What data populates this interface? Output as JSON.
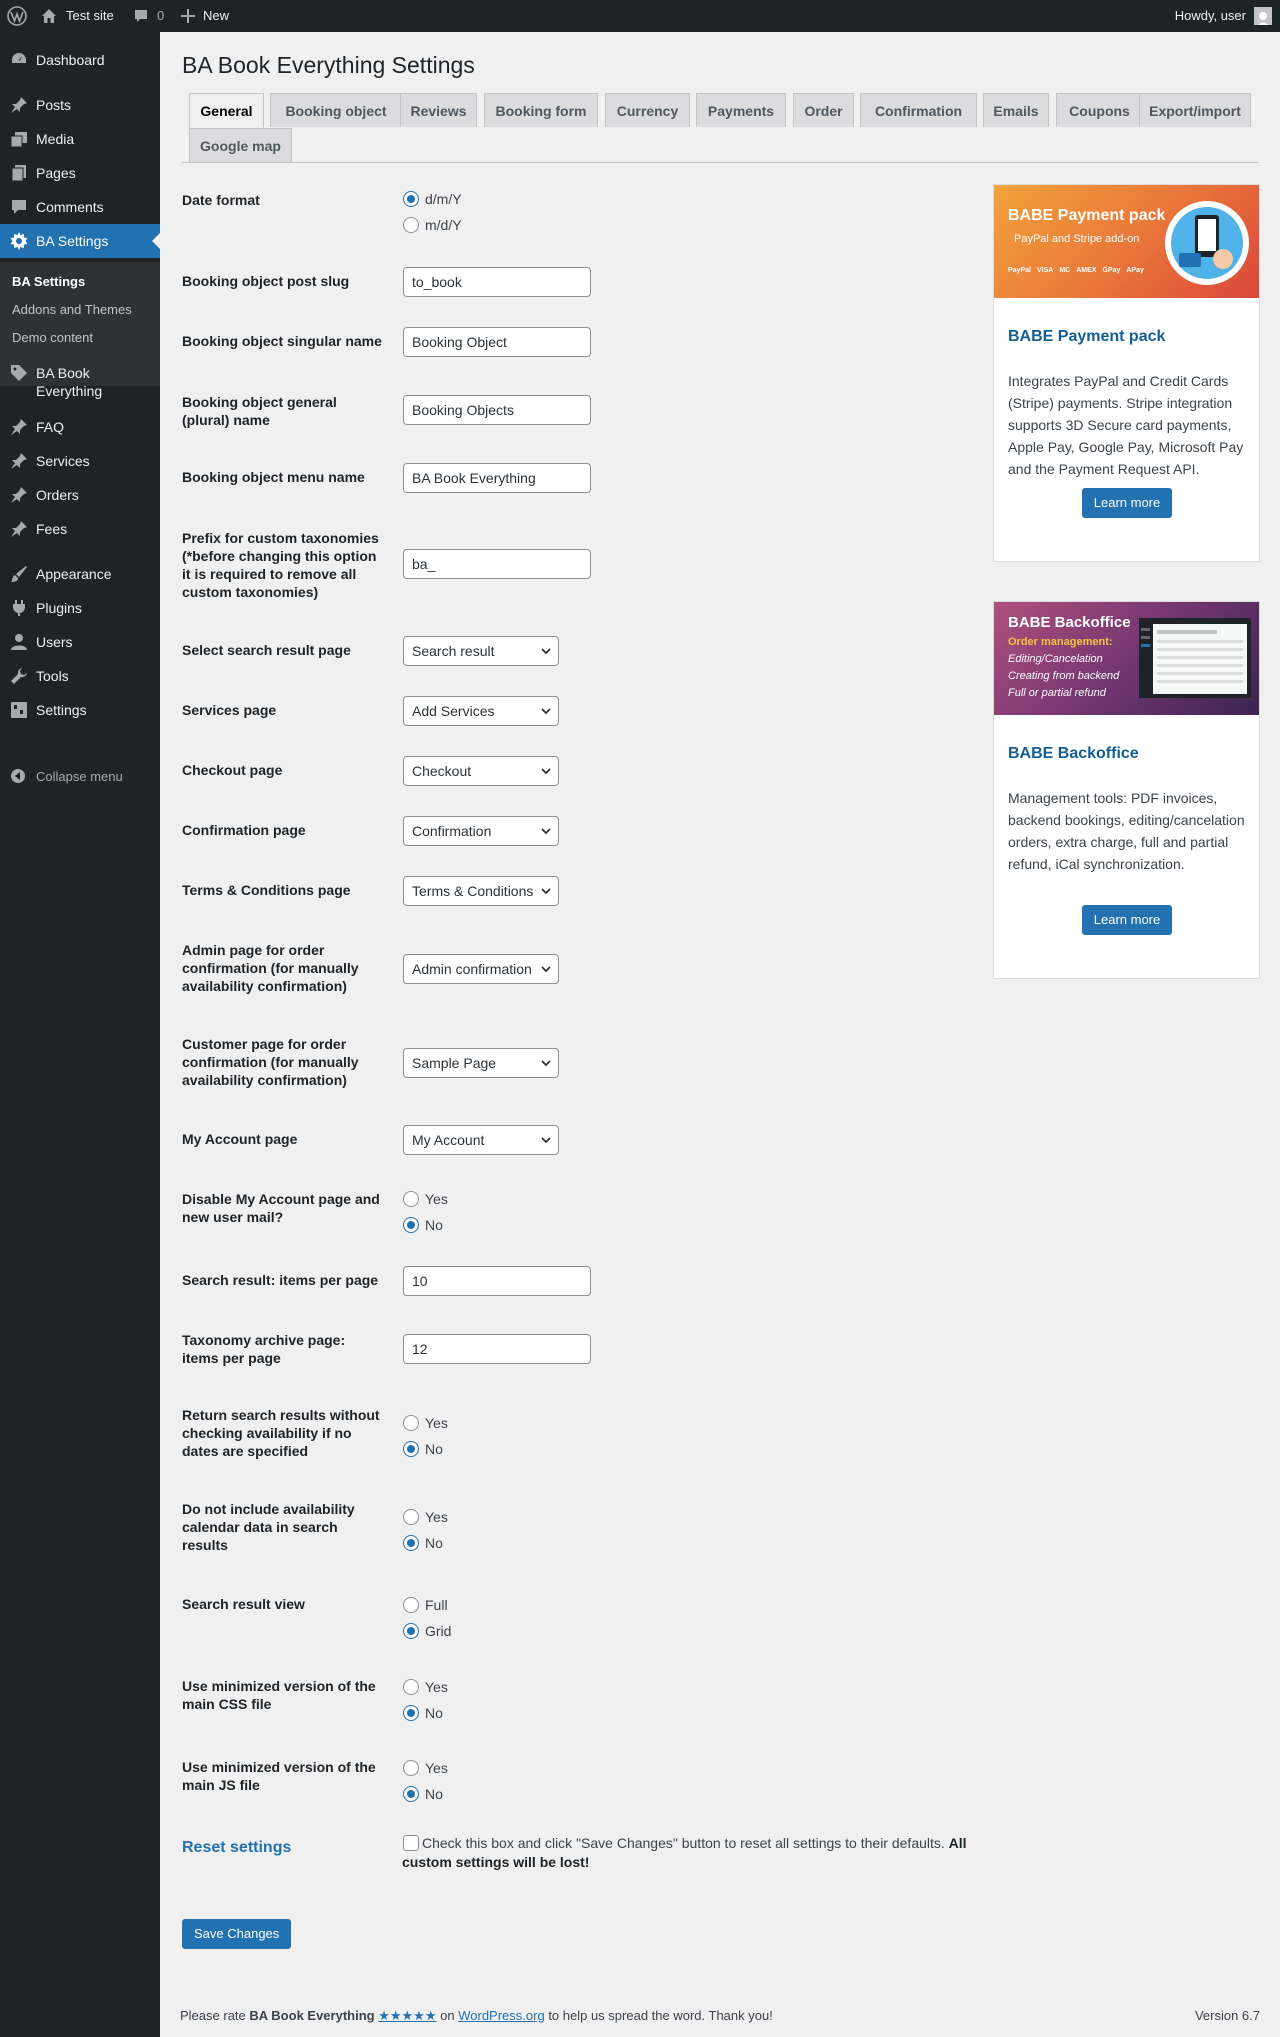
{
  "adminbar": {
    "site_name": "Test site",
    "comments_count": "0",
    "new_label": "New",
    "howdy": "Howdy, user"
  },
  "sidebar": {
    "items": [
      {
        "label": "Dashboard",
        "icon": "dashboard-icon"
      },
      {
        "label": "Posts",
        "icon": "pin-icon"
      },
      {
        "label": "Media",
        "icon": "media-icon"
      },
      {
        "label": "Pages",
        "icon": "pages-icon"
      },
      {
        "label": "Comments",
        "icon": "comments-icon"
      },
      {
        "label": "BA Settings",
        "icon": "gear-icon"
      },
      {
        "label": "BA Book Everything",
        "icon": "tag-icon"
      },
      {
        "label": "FAQ",
        "icon": "pin-icon"
      },
      {
        "label": "Services",
        "icon": "pin-icon"
      },
      {
        "label": "Orders",
        "icon": "pin-icon"
      },
      {
        "label": "Fees",
        "icon": "pin-icon"
      },
      {
        "label": "Appearance",
        "icon": "brush-icon"
      },
      {
        "label": "Plugins",
        "icon": "plugin-icon"
      },
      {
        "label": "Users",
        "icon": "user-icon"
      },
      {
        "label": "Tools",
        "icon": "wrench-icon"
      },
      {
        "label": "Settings",
        "icon": "settings-icon"
      }
    ],
    "submenu": [
      "BA Settings",
      "Addons and Themes",
      "Demo content"
    ],
    "collapse": "Collapse menu"
  },
  "page": {
    "title": "BA Book Everything Settings",
    "tabs": [
      "General",
      "Booking object",
      "Reviews",
      "Booking form",
      "Currency",
      "Payments",
      "Order",
      "Confirmation",
      "Emails",
      "Coupons",
      "Export/import",
      "Google map"
    ]
  },
  "settings": {
    "date_format": {
      "label": "Date format",
      "options": [
        "d/m/Y",
        "m/d/Y"
      ]
    },
    "post_slug": {
      "label": "Booking object post slug",
      "value": "to_book"
    },
    "singular_name": {
      "label": "Booking object singular name",
      "value": "Booking Object"
    },
    "plural_name": {
      "label": "Booking object general (plural) name",
      "value": "Booking Objects"
    },
    "menu_name": {
      "label": "Booking object menu name",
      "value": "BA Book Everything"
    },
    "tax_prefix": {
      "label": "Prefix for custom taxonomies (*before changing this option it is required to remove all custom taxonomies)",
      "value": "ba_"
    },
    "search_page": {
      "label": "Select search result page",
      "value": "Search result"
    },
    "services_page": {
      "label": "Services page",
      "value": "Add Services"
    },
    "checkout_page": {
      "label": "Checkout page",
      "value": "Checkout"
    },
    "confirmation_page": {
      "label": "Confirmation page",
      "value": "Confirmation"
    },
    "terms_page": {
      "label": "Terms & Conditions page",
      "value": "Terms & Conditions"
    },
    "admin_confirm_page": {
      "label": "Admin page for order confirmation (for manually availability confirmation)",
      "value": "Admin confirmation"
    },
    "customer_confirm_page": {
      "label": "Customer page for order confirmation (for manually availability confirmation)",
      "value": "Sample Page"
    },
    "account_page": {
      "label": "My Account page",
      "value": "My Account"
    },
    "disable_account": {
      "label": "Disable My Account page and new user mail?",
      "options": [
        "Yes",
        "No"
      ]
    },
    "items_per_page": {
      "label": "Search result: items per page",
      "value": "10"
    },
    "taxonomy_per_page": {
      "label": "Taxonomy archive page: items per page",
      "value": "12"
    },
    "no_dates_check": {
      "label": "Return search results without checking availability if no dates are specified",
      "options": [
        "Yes",
        "No"
      ]
    },
    "no_calendar_data": {
      "label": "Do not include availability calendar data in search results",
      "options": [
        "Yes",
        "No"
      ]
    },
    "result_view": {
      "label": "Search result view",
      "options": [
        "Full",
        "Grid"
      ]
    },
    "min_css": {
      "label": "Use minimized version of the main CSS file",
      "options": [
        "Yes",
        "No"
      ]
    },
    "min_js": {
      "label": "Use minimized version of the main JS file",
      "options": [
        "Yes",
        "No"
      ]
    },
    "reset": {
      "title": "Reset settings",
      "text": "Check this box and click \"Save Changes\" button to reset all settings to their defaults.",
      "warning": "All custom settings will be lost!"
    },
    "save_label": "Save Changes"
  },
  "promos": [
    {
      "banner_title": "BABE Payment pack",
      "banner_sub": "PayPal and Stripe add-on",
      "banner_logos": [
        "PayPal",
        "VISA",
        "MC",
        "AMEX",
        "GPay",
        "APay"
      ],
      "title": "BABE Payment pack",
      "desc": "Integrates PayPal and Credit Cards (Stripe) payments. Stripe integration supports 3D Secure card payments, Apple Pay, Google Pay, Microsoft Pay and the Payment Request API.",
      "button": "Learn more"
    },
    {
      "banner_title": "BABE Backoffice",
      "banner_sub": "Order management:",
      "banner_lines": [
        "Editing/Cancelation",
        "Creating from backend",
        "Full or partial refund"
      ],
      "title": "BABE Backoffice",
      "desc": "Management tools: PDF invoices, backend bookings, editing/cancelation orders, extra charge, full and partial refund, iCal synchronization.",
      "button": "Learn more"
    }
  ],
  "footer": {
    "prefix": "Please rate",
    "plugin": "BA Book Everything",
    "stars": "★★★★★",
    "on": "on",
    "link": "WordPress.org",
    "suffix": "to help us spread the word. Thank you!",
    "version": "Version 6.7"
  }
}
